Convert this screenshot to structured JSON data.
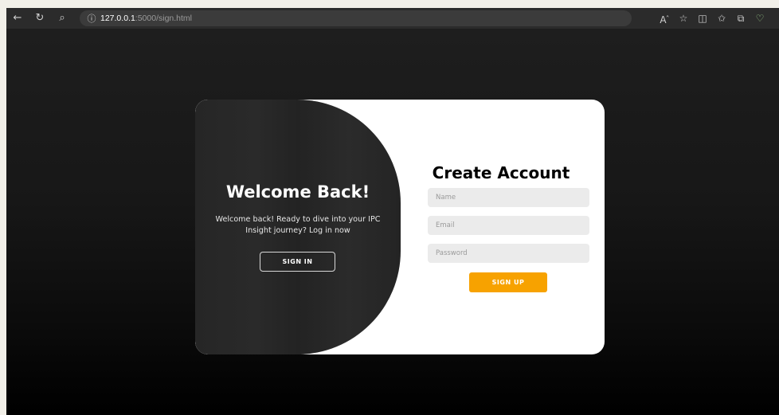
{
  "browser": {
    "url_host": "127.0.0.1",
    "url_rest": ":5000/sign.html",
    "icons": [
      "back-arrow-icon",
      "refresh-icon",
      "search-icon",
      "info-icon",
      "read-aloud-icon",
      "favorite-star-icon",
      "split-screen-icon",
      "favorites-list-icon",
      "collections-icon",
      "health-icon"
    ]
  },
  "left_panel": {
    "title": "Welcome Back!",
    "message": "Welcome back! Ready to dive into your IPC Insight journey? Log in now",
    "button_label": "SIGN IN"
  },
  "form": {
    "title": "Create Account",
    "name_placeholder": "Name",
    "email_placeholder": "Email",
    "password_placeholder": "Password",
    "submit_label": "SIGN UP"
  },
  "colors": {
    "accent": "#f7a200",
    "panel": "#262626",
    "background": "#000000"
  }
}
